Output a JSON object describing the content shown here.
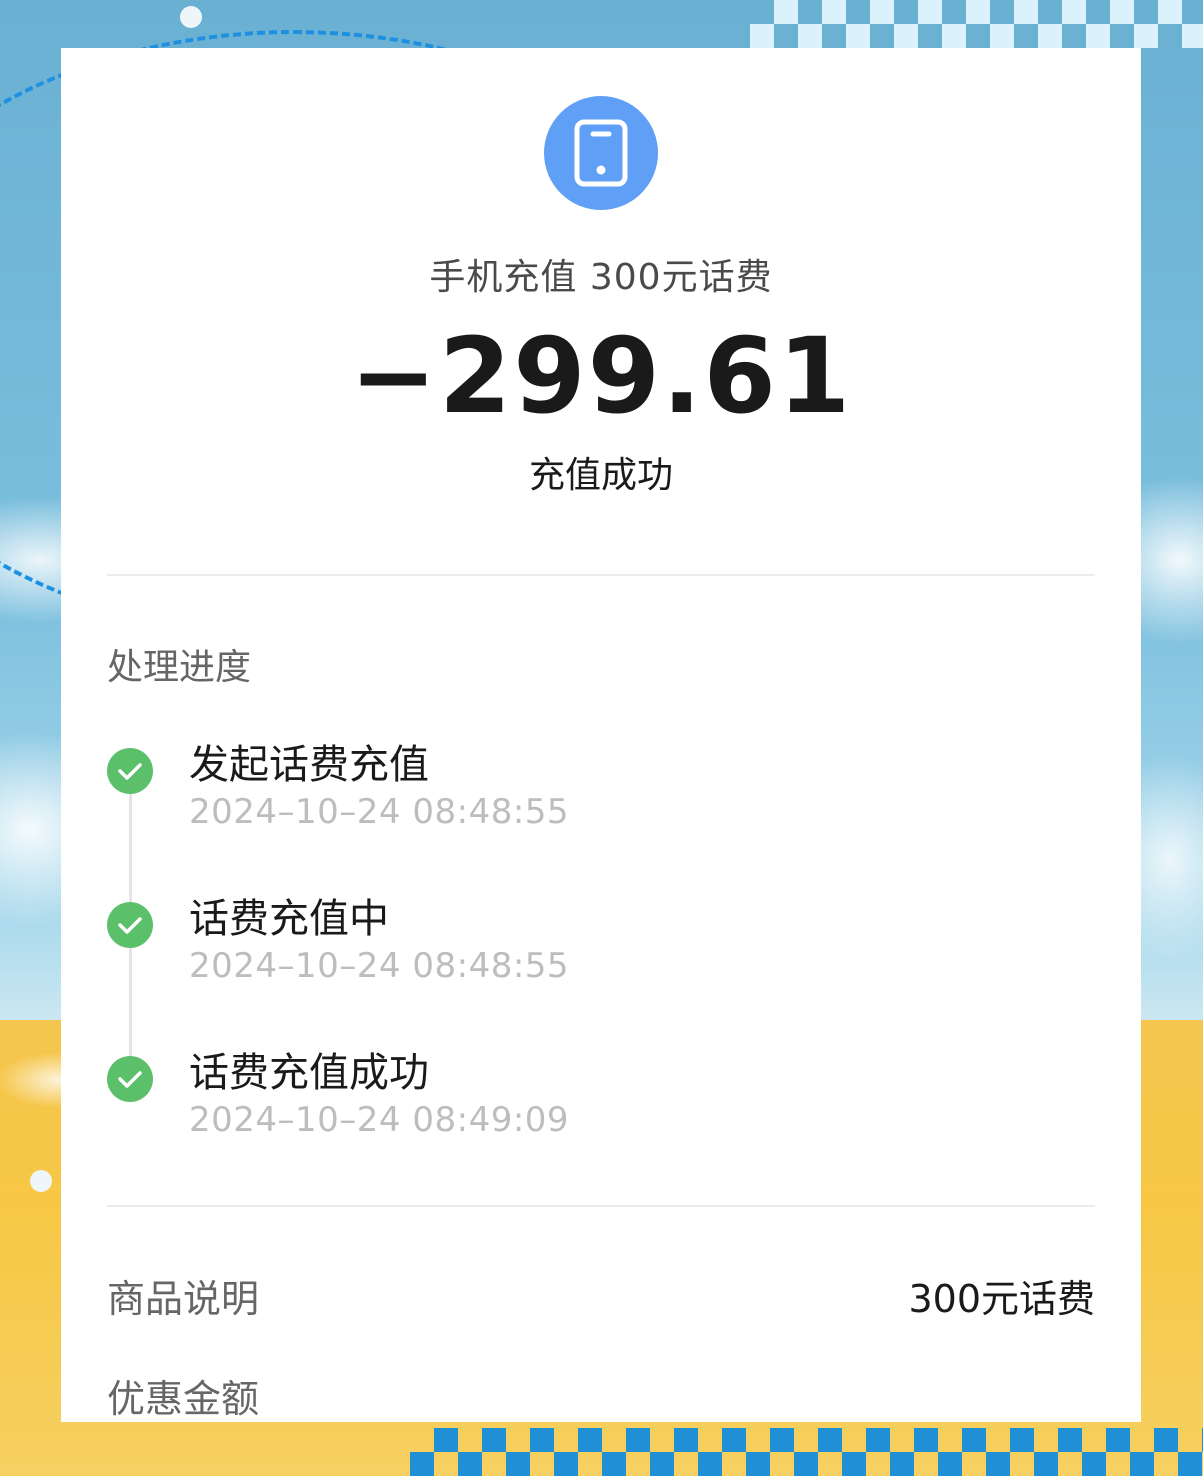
{
  "colors": {
    "accent_blue": "#5f9ff5",
    "success_green": "#5cbf6a",
    "text_primary": "#1a1a1a",
    "text_secondary": "#666666",
    "text_muted": "#bdbdbd"
  },
  "header": {
    "icon": "phone-icon",
    "title": "手机充值 300元话费",
    "amount": "−299.61",
    "status": "充值成功"
  },
  "progress": {
    "title": "处理进度",
    "steps": [
      {
        "icon": "check-icon",
        "label": "发起话费充值",
        "time": "2024–10–24 08:48:55"
      },
      {
        "icon": "check-icon",
        "label": "话费充值中",
        "time": "2024–10–24 08:48:55"
      },
      {
        "icon": "check-icon",
        "label": "话费充值成功",
        "time": "2024–10–24 08:49:09"
      }
    ]
  },
  "details": {
    "rows": [
      {
        "label": "商品说明",
        "value": "300元话费"
      },
      {
        "label": "优惠金额",
        "value": ""
      }
    ]
  }
}
